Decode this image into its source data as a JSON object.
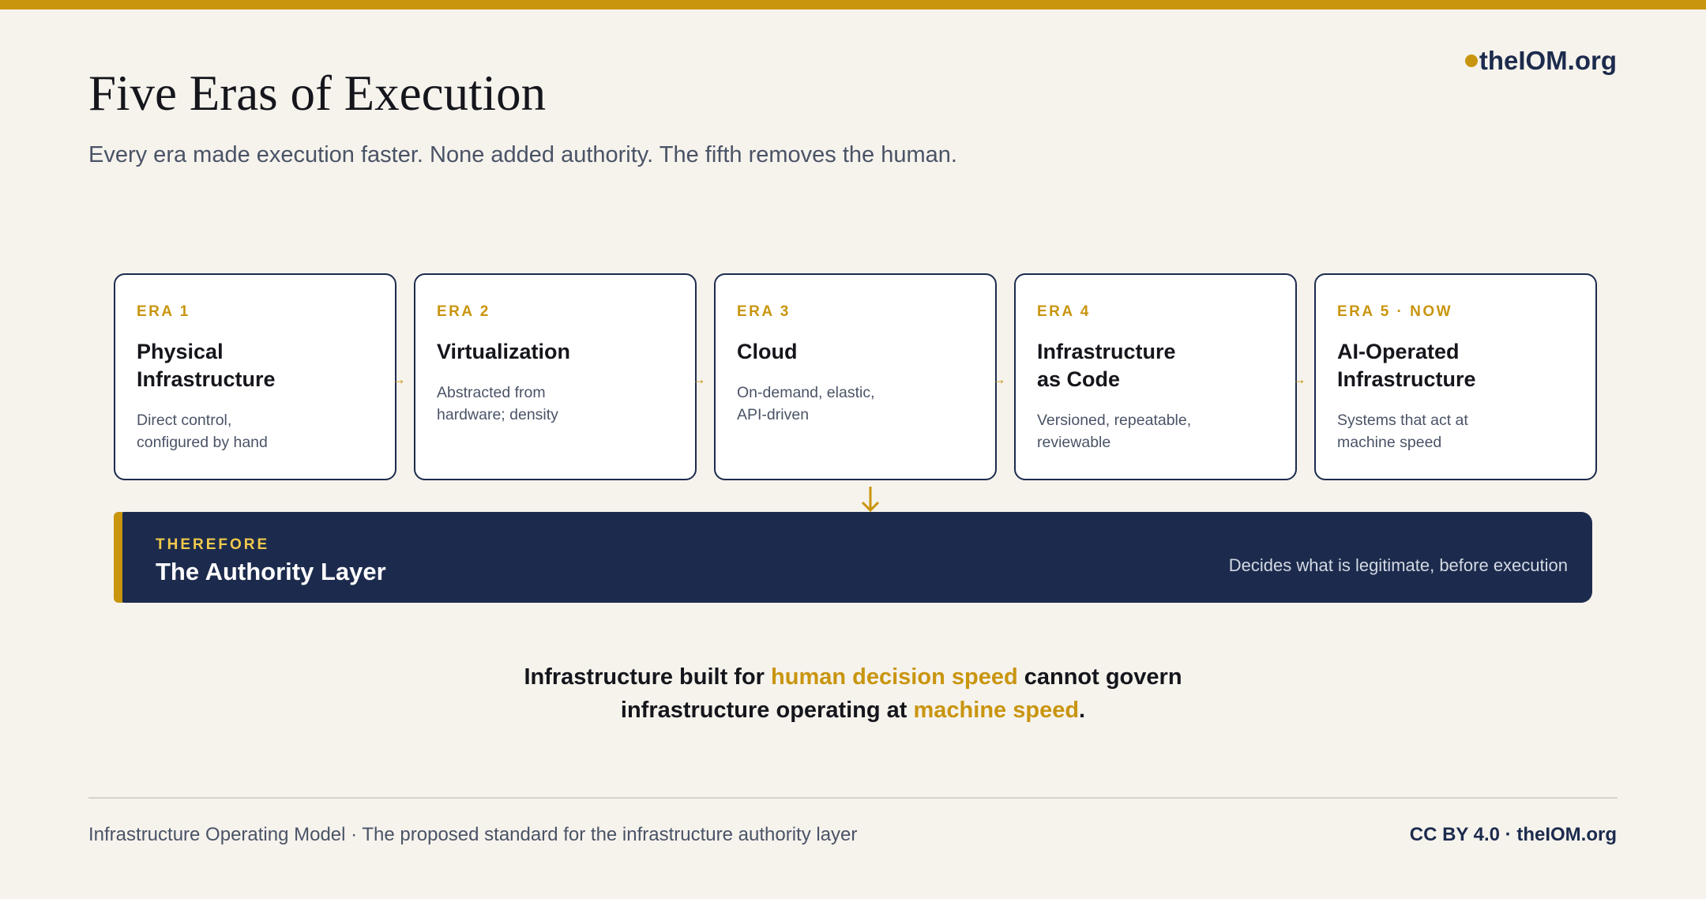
{
  "brand": {
    "logo_text": "theIOM.org",
    "accent_color": "#c9950f",
    "navy_color": "#1c2b4d"
  },
  "header": {
    "title": "Five Eras of Execution",
    "subtitle": "Every era made execution faster. None added authority. The fifth removes the human."
  },
  "eras": [
    {
      "label": "ERA 1",
      "name": "Physical\nInfrastructure",
      "desc": "Direct control,\nconfigured by hand"
    },
    {
      "label": "ERA 2",
      "name": "Virtualization",
      "desc": "Abstracted from\nhardware; density"
    },
    {
      "label": "ERA 3",
      "name": "Cloud",
      "desc": "On-demand, elastic,\nAPI-driven"
    },
    {
      "label": "ERA 4",
      "name": "Infrastructure\nas Code",
      "desc": "Versioned, repeatable,\nreviewable"
    },
    {
      "label": "ERA 5 · NOW",
      "name": "AI-Operated\nInfrastructure",
      "desc": "Systems that act at\nmachine speed"
    }
  ],
  "connectors": {
    "arrow_glyph": "→"
  },
  "authority": {
    "kicker": "THEREFORE",
    "title": "The Authority Layer",
    "desc": "Decides what is legitimate, before execution"
  },
  "conclusion": {
    "p1": "Infrastructure built for ",
    "h1": "human decision speed",
    "p2": " cannot govern",
    "p3": "infrastructure operating at ",
    "h2": "machine speed",
    "p4": "."
  },
  "footer": {
    "left": "Infrastructure Operating Model · The proposed standard for the infrastructure authority layer",
    "right": "CC BY 4.0 · theIOM.org"
  }
}
